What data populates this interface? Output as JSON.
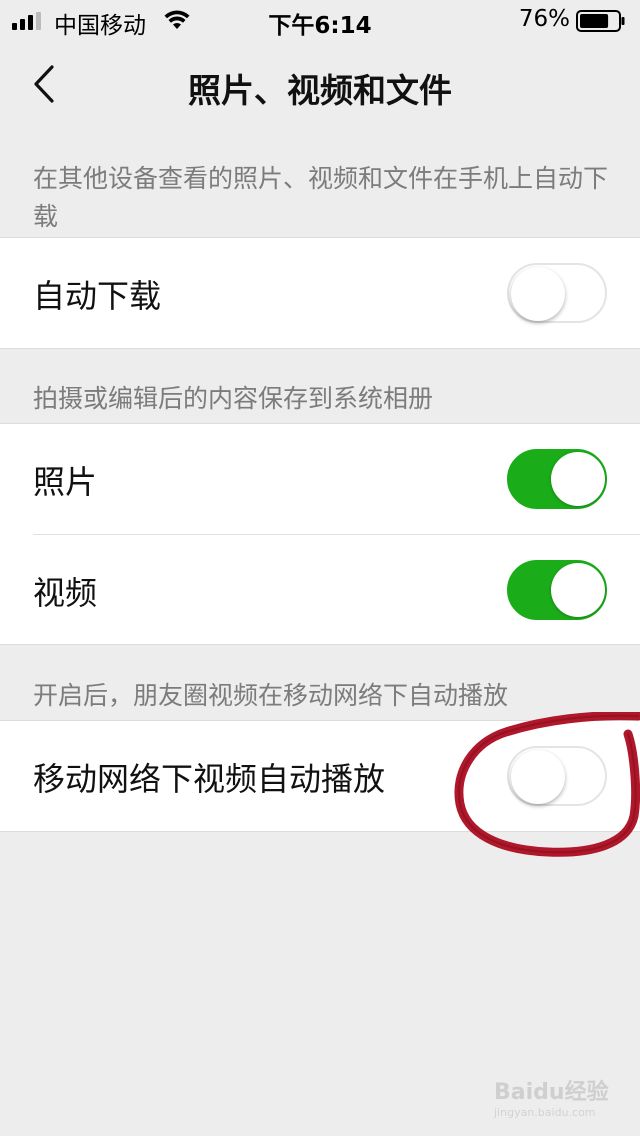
{
  "status_bar": {
    "carrier": "中国移动",
    "time": "下午6:14",
    "battery_percent": "76%",
    "battery_level": 0.76
  },
  "nav": {
    "title": "照片、视频和文件"
  },
  "sections": [
    {
      "header": "在其他设备查看的照片、视频和文件在手机上自动下载",
      "rows": [
        {
          "label": "自动下载",
          "enabled": false
        }
      ]
    },
    {
      "header": "拍摄或编辑后的内容保存到系统相册",
      "rows": [
        {
          "label": "照片",
          "enabled": true
        },
        {
          "label": "视频",
          "enabled": true
        }
      ]
    },
    {
      "header": "开启后，朋友圈视频在移动网络下自动播放",
      "rows": [
        {
          "label": "移动网络下视频自动播放",
          "enabled": false
        }
      ]
    }
  ],
  "colors": {
    "accent_green": "#1aad19",
    "annotation_red": "#b0172b",
    "background": "#ededed"
  },
  "watermark": {
    "text": "Baidu经验",
    "sub": "jingyan.baidu.com"
  }
}
